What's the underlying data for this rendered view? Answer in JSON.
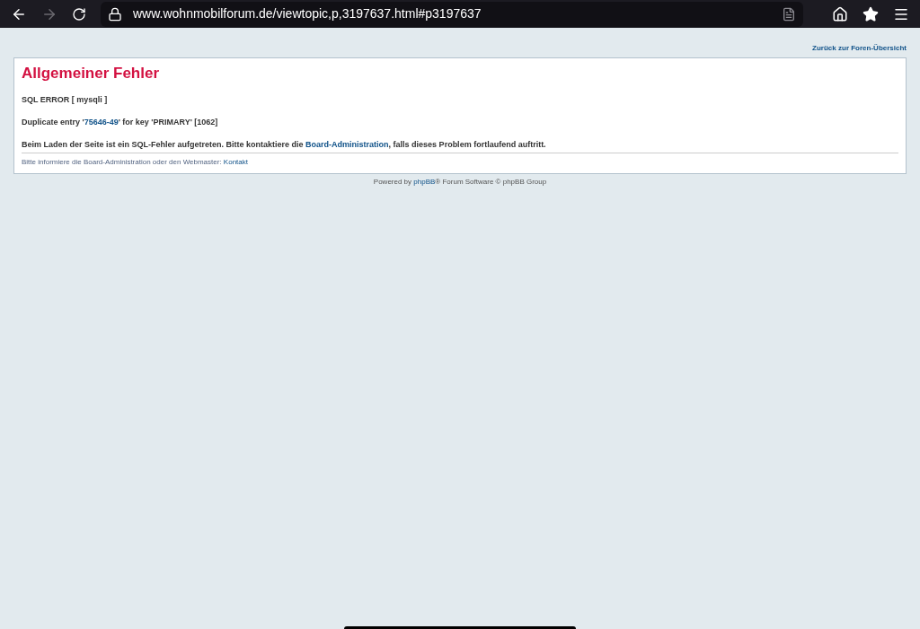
{
  "browser": {
    "url": "www.wohnmobilforum.de/viewtopic,p,3197637.html#p3197637",
    "back_disabled": false,
    "forward_disabled": true
  },
  "top_link": "Zurück zur Foren-Übersicht",
  "panel": {
    "title": "Allgemeiner Fehler",
    "lines": [
      {
        "parts": [
          {
            "kind": "text",
            "text": "SQL ERROR [ mysqli ]"
          }
        ]
      },
      {
        "parts": [
          {
            "kind": "text",
            "text": "Duplicate entry '"
          },
          {
            "kind": "link",
            "text": "75646-49"
          },
          {
            "kind": "text",
            "text": "' for key 'PRIMARY' [1062]"
          }
        ]
      },
      {
        "parts": [
          {
            "kind": "text",
            "text": "Beim Laden der Seite ist ein SQL-Fehler aufgetreten. Bitte kontaktiere die "
          },
          {
            "kind": "link",
            "text": "Board-Administration"
          },
          {
            "kind": "text",
            "text": ", falls dieses Problem fortlaufend auftritt."
          }
        ]
      }
    ],
    "note": {
      "text": "Bitte informiere die Board-Administration oder den Webmaster:",
      "link": "Kontakt"
    }
  },
  "footer": {
    "before": "Powered by",
    "link": "phpBB",
    "after": "® Forum Software © phpBB Group"
  }
}
